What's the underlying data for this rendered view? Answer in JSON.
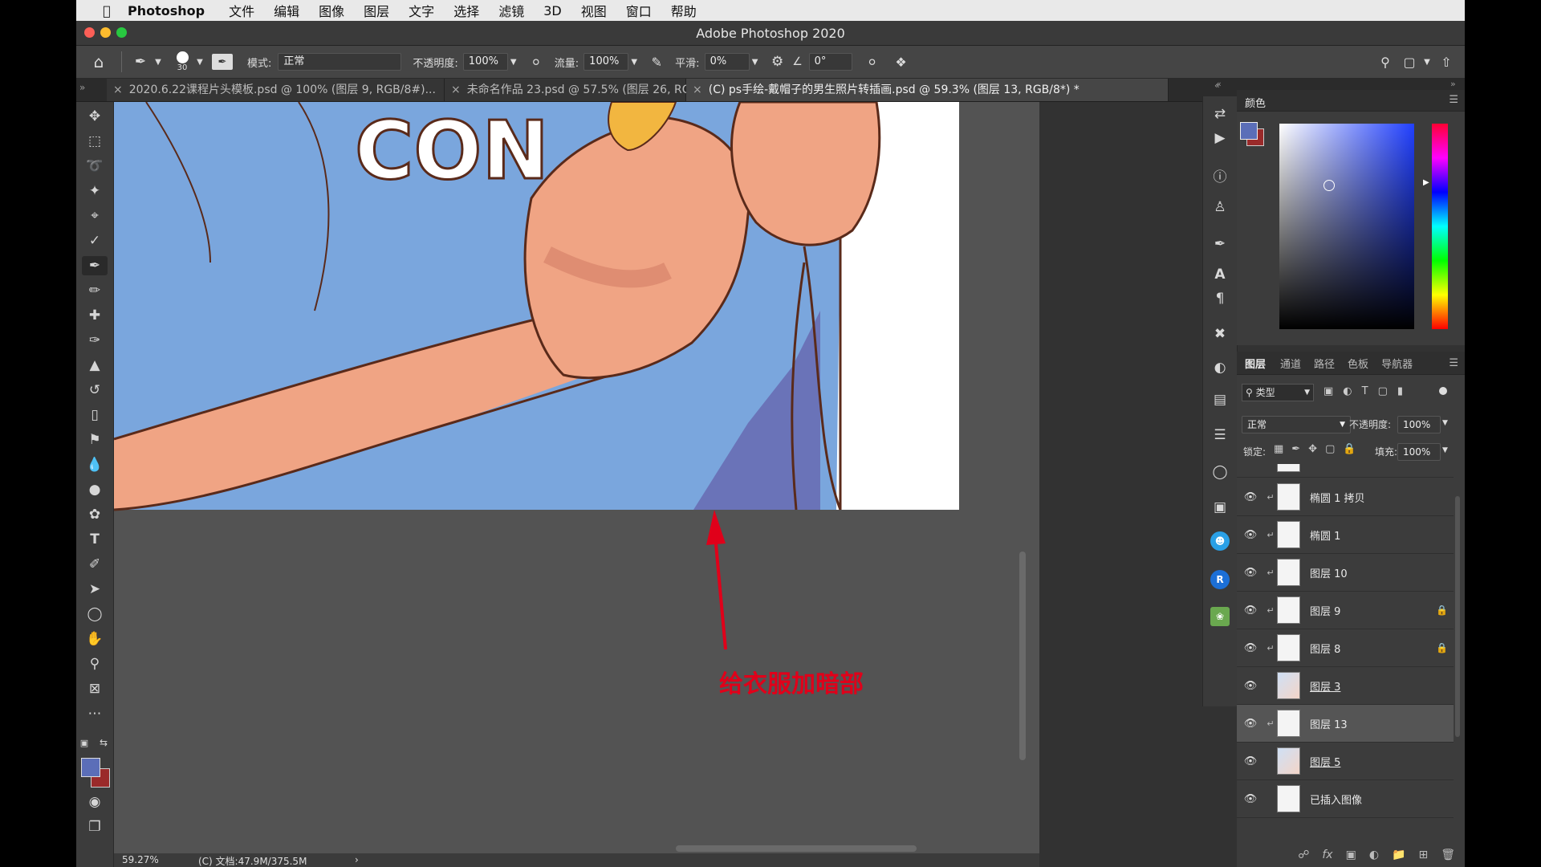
{
  "menubar": {
    "app": "Photoshop",
    "items": [
      "文件",
      "编辑",
      "图像",
      "图层",
      "文字",
      "选择",
      "滤镜",
      "3D",
      "视图",
      "窗口",
      "帮助"
    ]
  },
  "window_title": "Adobe Photoshop 2020",
  "options": {
    "brush_size": "30",
    "mode_label": "模式:",
    "mode_value": "正常",
    "opacity_label": "不透明度:",
    "opacity_value": "100%",
    "flow_label": "流量:",
    "flow_value": "100%",
    "smooth_label": "平滑:",
    "smooth_value": "0%",
    "angle_value": "0°"
  },
  "tabs": [
    {
      "label": "2020.6.22课程片头模板.psd @ 100% (图层 9, RGB/8#)..."
    },
    {
      "label": "未命名作品 23.psd @ 57.5% (图层 26, RGB/8*)..."
    },
    {
      "label": "(C) ps手绘-戴帽子的男生照片转插画.psd @ 59.3% (图层 13, RGB/8*) *"
    }
  ],
  "annotation": {
    "text": "给衣服加暗部",
    "color": "#e0001a"
  },
  "artwork": {
    "shirt_text": "CON"
  },
  "status": {
    "zoom": "59.27%",
    "doc": "(C) 文档:47.9M/375.5M",
    "arrow": "›"
  },
  "colors": {
    "foreground": "#5b6eb8",
    "background": "#9a2a2a",
    "shirt": "#7aa6dd",
    "shirt_shadow": "#6a73b8",
    "skin": "#f0a484",
    "skin_shadow": "#d47e66"
  },
  "color_panel": {
    "title": "颜色"
  },
  "layers_panel": {
    "tabs": [
      "图层",
      "通道",
      "路径",
      "色板",
      "导航器"
    ],
    "filter_label": "类型",
    "blend_mode": "正常",
    "opacity_label": "不透明度:",
    "opacity_value": "100%",
    "lock_label": "锁定:",
    "fill_label": "填充:",
    "fill_value": "100%",
    "layers": [
      {
        "name": "椭圆 1 拷贝",
        "clip": true,
        "locked": false,
        "selected": false,
        "underline": false
      },
      {
        "name": "椭圆 1",
        "clip": true,
        "locked": false,
        "selected": false,
        "underline": false
      },
      {
        "name": "图层 10",
        "clip": true,
        "locked": false,
        "selected": false,
        "underline": false
      },
      {
        "name": "图层 9",
        "clip": true,
        "locked": true,
        "selected": false,
        "underline": false
      },
      {
        "name": "图层 8",
        "clip": true,
        "locked": true,
        "selected": false,
        "underline": false
      },
      {
        "name": "图层 3",
        "clip": false,
        "locked": false,
        "selected": false,
        "underline": true
      },
      {
        "name": "图层 13",
        "clip": true,
        "locked": false,
        "selected": true,
        "underline": false
      },
      {
        "name": "图层 5",
        "clip": false,
        "locked": false,
        "selected": false,
        "underline": true
      },
      {
        "name": "已插入图像",
        "clip": false,
        "locked": false,
        "selected": false,
        "underline": false
      }
    ],
    "footer_fx": "fx"
  }
}
